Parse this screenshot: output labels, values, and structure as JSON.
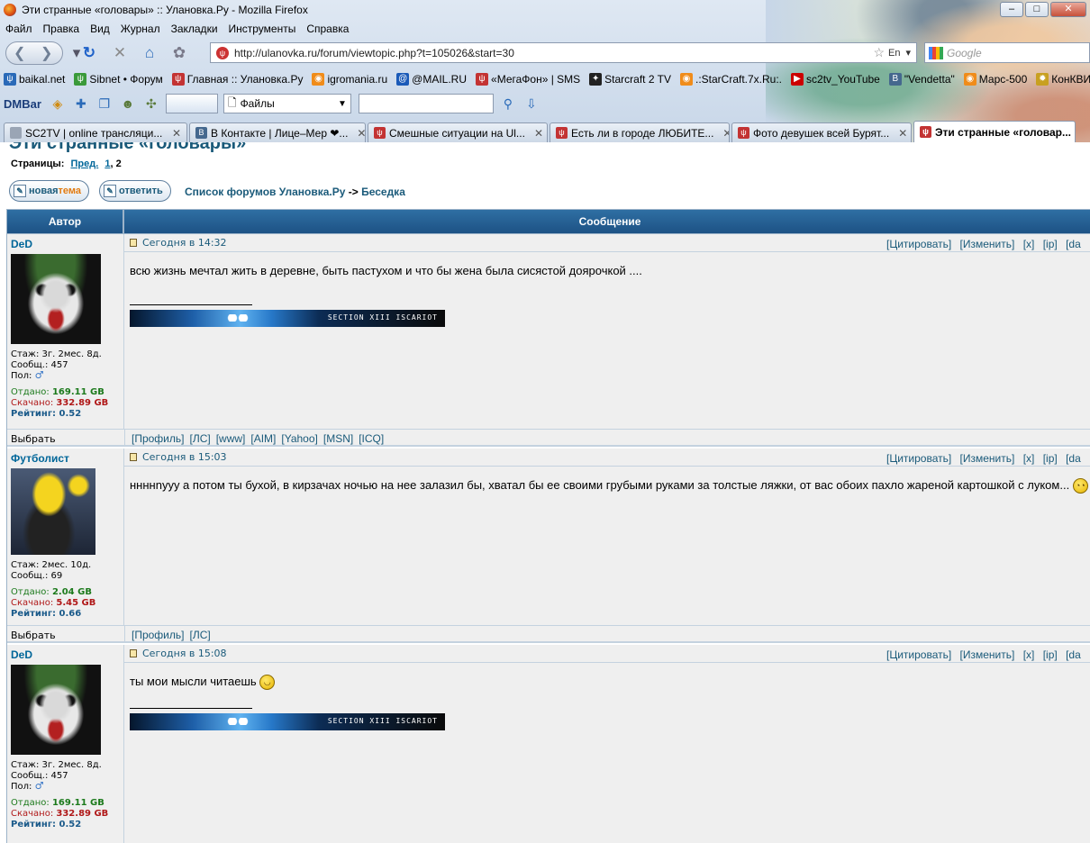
{
  "window": {
    "title": "Эти странные «головары» :: Улановка.Ру - Mozilla Firefox",
    "controls": [
      "–",
      "□",
      "✕"
    ]
  },
  "menu": [
    "Файл",
    "Правка",
    "Вид",
    "Журнал",
    "Закладки",
    "Инструменты",
    "Справка"
  ],
  "urlbar": {
    "url": "http://ulanovka.ru/forum/viewtopic.php?t=105026&start=30",
    "lang": "En"
  },
  "search": {
    "placeholder": "Google"
  },
  "bookmarks": [
    {
      "label": "baikal.net",
      "icon": "baikal-icon",
      "color": "#2a6ab8"
    },
    {
      "label": "Sibnet • Форум",
      "icon": "sibnet-icon",
      "color": "#3a9a3a"
    },
    {
      "label": "Главная :: Улановка.Ру",
      "icon": "ulanovka-icon",
      "color": "#c33333"
    },
    {
      "label": "igromania.ru",
      "icon": "rss-icon",
      "color": "#f08c1a"
    },
    {
      "label": "@MAIL.RU",
      "icon": "mailru-icon",
      "color": "#1a5ab8"
    },
    {
      "label": "«МегаФон» | SMS",
      "icon": "megafon-icon",
      "color": "#c33333"
    },
    {
      "label": "Starcraft 2 TV",
      "icon": "sc2tv-icon",
      "color": "#222222"
    },
    {
      "label": ".:StarCraft.7x.Ru:.",
      "icon": "rss-icon",
      "color": "#f08c1a"
    },
    {
      "label": "sc2tv_YouTube",
      "icon": "youtube-icon",
      "color": "#cc0000"
    },
    {
      "label": "\"Vendetta\"",
      "icon": "vkontakte-icon",
      "color": "#45688e"
    },
    {
      "label": "Марс-500",
      "icon": "rss-icon",
      "color": "#f08c1a"
    },
    {
      "label": "КонКВИЗта",
      "icon": "konkvizta-icon",
      "color": "#c8a020"
    }
  ],
  "dmbar": {
    "logo": "DMBar",
    "dropdown": "Файлы"
  },
  "tabs": [
    {
      "label": "SC2TV | online трансляци...",
      "icon": "page-icon",
      "color": "#9aa5b5",
      "width": 204
    },
    {
      "label": "В Контакте | Лице–Мер ❤...",
      "icon": "vkontakte-icon",
      "color": "#45688e",
      "width": 196
    },
    {
      "label": "Смешные ситуации на Ul...",
      "icon": "ulanovka-icon",
      "color": "#c33333",
      "width": 200
    },
    {
      "label": "Есть ли в городе ЛЮБИТЕ...",
      "icon": "ulanovka-icon",
      "color": "#c33333",
      "width": 200
    },
    {
      "label": "Фото девушек всей Бурят...",
      "icon": "ulanovka-icon",
      "color": "#c33333",
      "width": 200
    },
    {
      "label": "Эти странные «головар...",
      "icon": "ulanovka-icon",
      "color": "#c33333",
      "width": 180,
      "active": true
    }
  ],
  "page": {
    "topic_title": "Эти странные «головары»",
    "pages_label": "Страницы:",
    "prev": "Пред.",
    "page1": "1",
    "page2": ", 2",
    "new_topic": {
      "a": "новая ",
      "b": "тема"
    },
    "reply": "ответить",
    "forum_index": "Список форумов Улановка.Ру",
    "arrow": " -> ",
    "subforum": "Беседка",
    "col_author": "Автор",
    "col_message": "Сообщение"
  },
  "posts": [
    {
      "author": "DeD",
      "avatar": "joker",
      "date": "Сегодня в 14:32",
      "text": "всю жизнь мечтал жить в деревне, быть пастухом и что бы жена была сисястой доярочкой ....",
      "smiley": "",
      "signature": "SECTION XIII ISCARIOT",
      "stats": {
        "stazh": "Стаж: 3г. 2мес. 8д.",
        "soobsh": "Сообщ.: 457",
        "pol": "Пол:",
        "otdano_label": "Отдано: ",
        "otdano": "169.11 GB",
        "skachano_label": "Скачано: ",
        "skachano": "332.89 GB",
        "rating_label": "Рейтинг: ",
        "rating": "0.52"
      },
      "footer_links": [
        "[Профиль]",
        "[ЛС]",
        "[www]",
        "[AIM]",
        "[Yahoo]",
        "[MSN]",
        "[ICQ]"
      ]
    },
    {
      "author": "Футболист",
      "avatar": "homer",
      "date": "Сегодня в 15:03",
      "text": "ннннnууу а потом ты бухой, в кирзачах ночью на нее залазил бы, хватал бы ее своими грубыми руками за толстые ляжки, от вас обоих пахло жареной картошкой с луком...",
      "smiley": "rolleyes-smiley",
      "signature": "",
      "stats": {
        "stazh": "Стаж: 2мес. 10д.",
        "soobsh": "Сообщ.: 69",
        "pol": "",
        "otdano_label": "Отдано: ",
        "otdano": "2.04 GB",
        "skachano_label": "Скачано: ",
        "skachano": "5.45 GB",
        "rating_label": "Рейтинг: ",
        "rating": "0.66"
      },
      "footer_links": [
        "[Профиль]",
        "[ЛС]"
      ]
    },
    {
      "author": "DeD",
      "avatar": "joker",
      "date": "Сегодня в 15:08",
      "text": "ты мои мысли читаешь",
      "smiley": "laugh-smiley",
      "signature": "SECTION XIII ISCARIOT",
      "stats": {
        "stazh": "Стаж: 3г. 2мес. 8д.",
        "soobsh": "Сообщ.: 457",
        "pol": "Пол:",
        "otdano_label": "Отдано: ",
        "otdano": "169.11 GB",
        "skachano_label": "Скачано: ",
        "skachano": "332.89 GB",
        "rating_label": "Рейтинг: ",
        "rating": "0.52"
      },
      "footer_links": []
    }
  ],
  "post_actions": [
    "[Цитировать]",
    "[Изменить]",
    "[x]",
    "[ip]",
    "[da"
  ],
  "select_label": "Выбрать"
}
